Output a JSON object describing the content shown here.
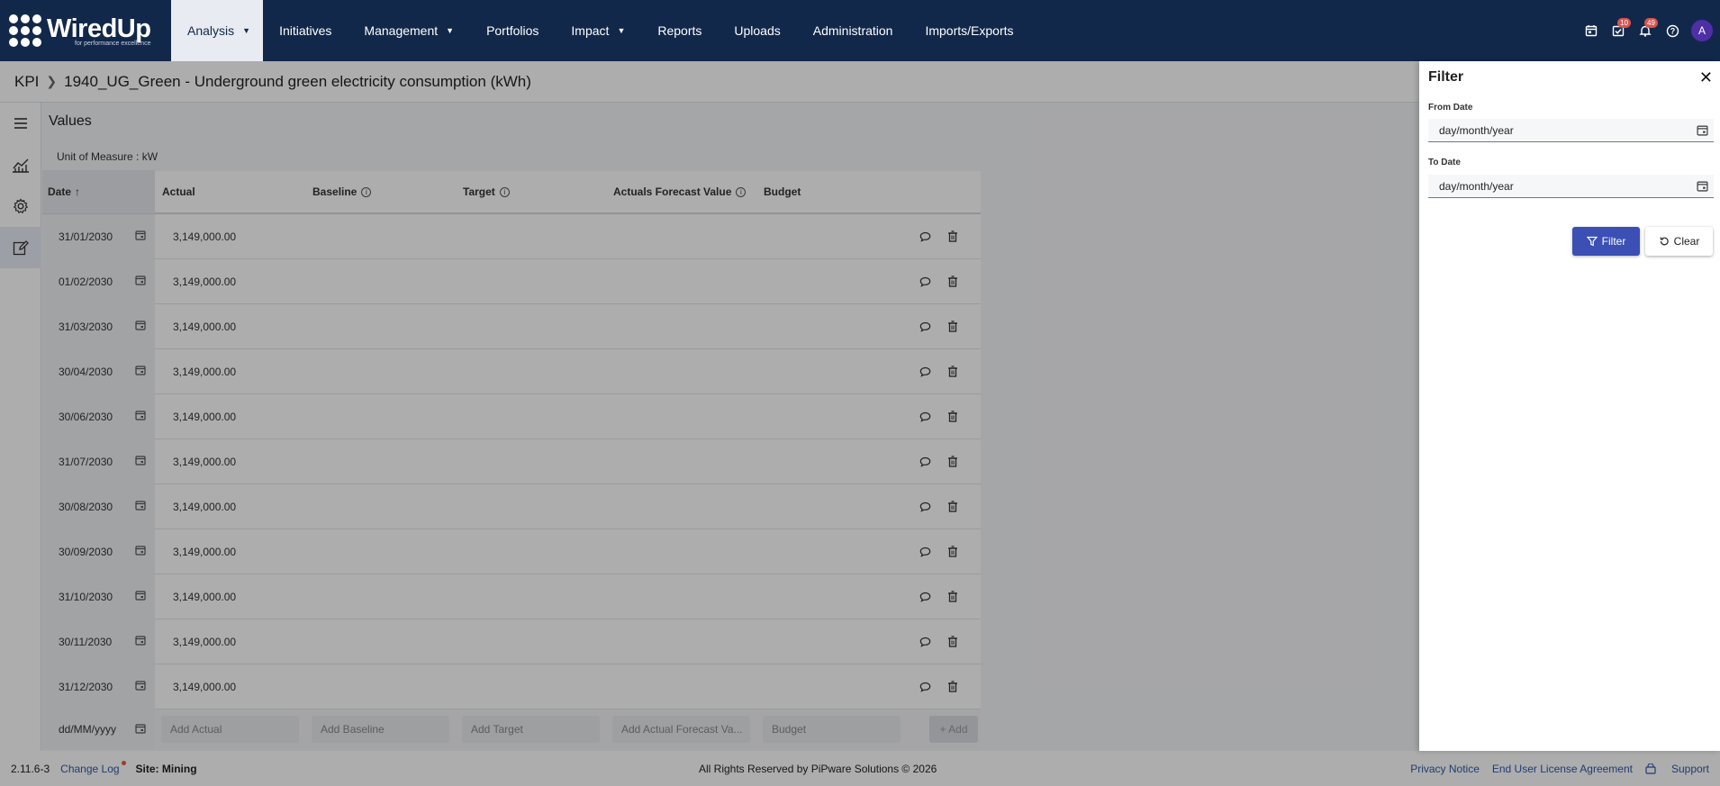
{
  "brand": {
    "name": "WiredUp",
    "tagline": "for performance excellence"
  },
  "nav": {
    "items": [
      {
        "label": "Analysis",
        "caret": true,
        "active": true
      },
      {
        "label": "Initiatives"
      },
      {
        "label": "Management",
        "caret": true
      },
      {
        "label": "Portfolios"
      },
      {
        "label": "Impact",
        "caret": true
      },
      {
        "label": "Reports"
      },
      {
        "label": "Uploads"
      },
      {
        "label": "Administration"
      },
      {
        "label": "Imports/Exports"
      }
    ],
    "icons": {
      "calendar_icon": "calendar-icon",
      "tasks_badge": "10",
      "notifications_badge": "49",
      "avatar_initial": "A"
    }
  },
  "breadcrumb": {
    "root": "KPI",
    "current": "1940_UG_Green - Underground green electricity consumption (kWh)"
  },
  "page": {
    "section_title": "Values",
    "unit_of_measure": "Unit of Measure : kW"
  },
  "table": {
    "headers": {
      "date": "Date",
      "date_sort": "↑",
      "actual": "Actual",
      "baseline": "Baseline",
      "target": "Target",
      "afv": "Actuals Forecast Value",
      "budget": "Budget"
    },
    "rows": [
      {
        "date": "31/01/2030",
        "actual": "3,149,000.00"
      },
      {
        "date": "01/02/2030",
        "actual": "3,149,000.00"
      },
      {
        "date": "31/03/2030",
        "actual": "3,149,000.00"
      },
      {
        "date": "30/04/2030",
        "actual": "3,149,000.00"
      },
      {
        "date": "30/06/2030",
        "actual": "3,149,000.00"
      },
      {
        "date": "31/07/2030",
        "actual": "3,149,000.00"
      },
      {
        "date": "30/08/2030",
        "actual": "3,149,000.00"
      },
      {
        "date": "30/09/2030",
        "actual": "3,149,000.00"
      },
      {
        "date": "31/10/2030",
        "actual": "3,149,000.00"
      },
      {
        "date": "30/11/2030",
        "actual": "3,149,000.00"
      },
      {
        "date": "31/12/2030",
        "actual": "3,149,000.00"
      }
    ],
    "add_row": {
      "date_placeholder": "dd/MM/yyyy",
      "actual_placeholder": "Add Actual",
      "baseline_placeholder": "Add Baseline",
      "target_placeholder": "Add Target",
      "afv_placeholder": "Add Actual Forecast Va...",
      "budget_placeholder": "Budget",
      "add_label": "+ Add"
    }
  },
  "filter": {
    "title": "Filter",
    "close": "✕",
    "from_label": "From Date",
    "from_value": "day/month/year",
    "to_label": "To Date",
    "to_value": "day/month/year",
    "filter_button": "Filter",
    "clear_button": "Clear"
  },
  "footer": {
    "version": "2.11.6-3",
    "change_log": "Change Log",
    "site": "Site: Mining",
    "copyright": "All Rights Reserved by PiPware Solutions © 2026",
    "privacy": "Privacy Notice",
    "eula": "End User License Agreement",
    "support": "Support"
  },
  "colors": {
    "nav_bg": "#12284a",
    "primary_button": "#3b4fb5",
    "link": "#2e5aa8",
    "avatar": "#4e2fa8"
  }
}
